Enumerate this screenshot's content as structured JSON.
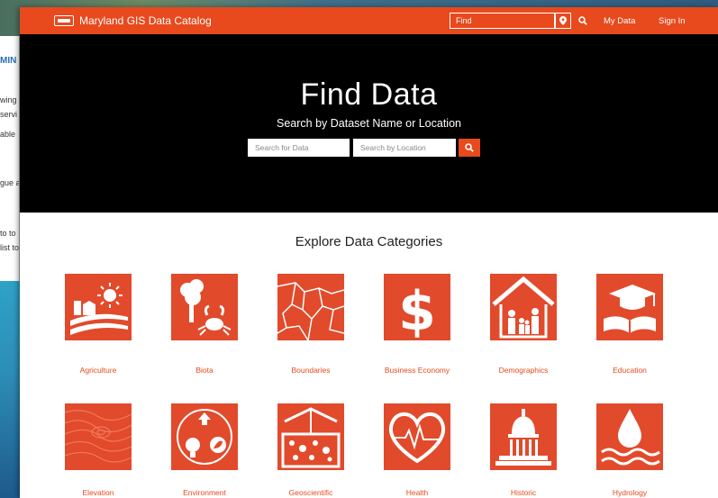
{
  "behind": {
    "heading": "MIN",
    "lines": [
      "wing",
      "servi",
      "able",
      "gue a",
      "to to",
      "list to"
    ]
  },
  "topbar": {
    "title": "Maryland GIS Data Catalog",
    "find_value": "Find",
    "my_data": "My Data",
    "sign_in": "Sign In",
    "color": "#e8491d"
  },
  "hero": {
    "title": "Find Data",
    "subtitle": "Search by Dataset Name or Location",
    "search_placeholder": "Search for Data",
    "location_placeholder": "Search by Location"
  },
  "explore": {
    "title": "Explore Data Categories"
  },
  "categories": [
    {
      "label": "Agriculture",
      "icon": "farm-icon"
    },
    {
      "label": "Biota",
      "icon": "tree-crab-icon"
    },
    {
      "label": "Boundaries",
      "icon": "map-boundaries-icon"
    },
    {
      "label": "Business Economy",
      "icon": "dollar-icon"
    },
    {
      "label": "Demographics",
      "icon": "family-house-icon"
    },
    {
      "label": "Education",
      "icon": "graduation-book-icon"
    },
    {
      "label": "Elevation",
      "icon": "contour-icon"
    },
    {
      "label": "Environment",
      "icon": "recycle-bulb-leaf-icon"
    },
    {
      "label": "Geoscientific",
      "icon": "geoscience-icon"
    },
    {
      "label": "Health",
      "icon": "heart-pulse-icon"
    },
    {
      "label": "Historic",
      "icon": "capitol-icon"
    },
    {
      "label": "Hydrology",
      "icon": "water-drop-icon"
    }
  ]
}
